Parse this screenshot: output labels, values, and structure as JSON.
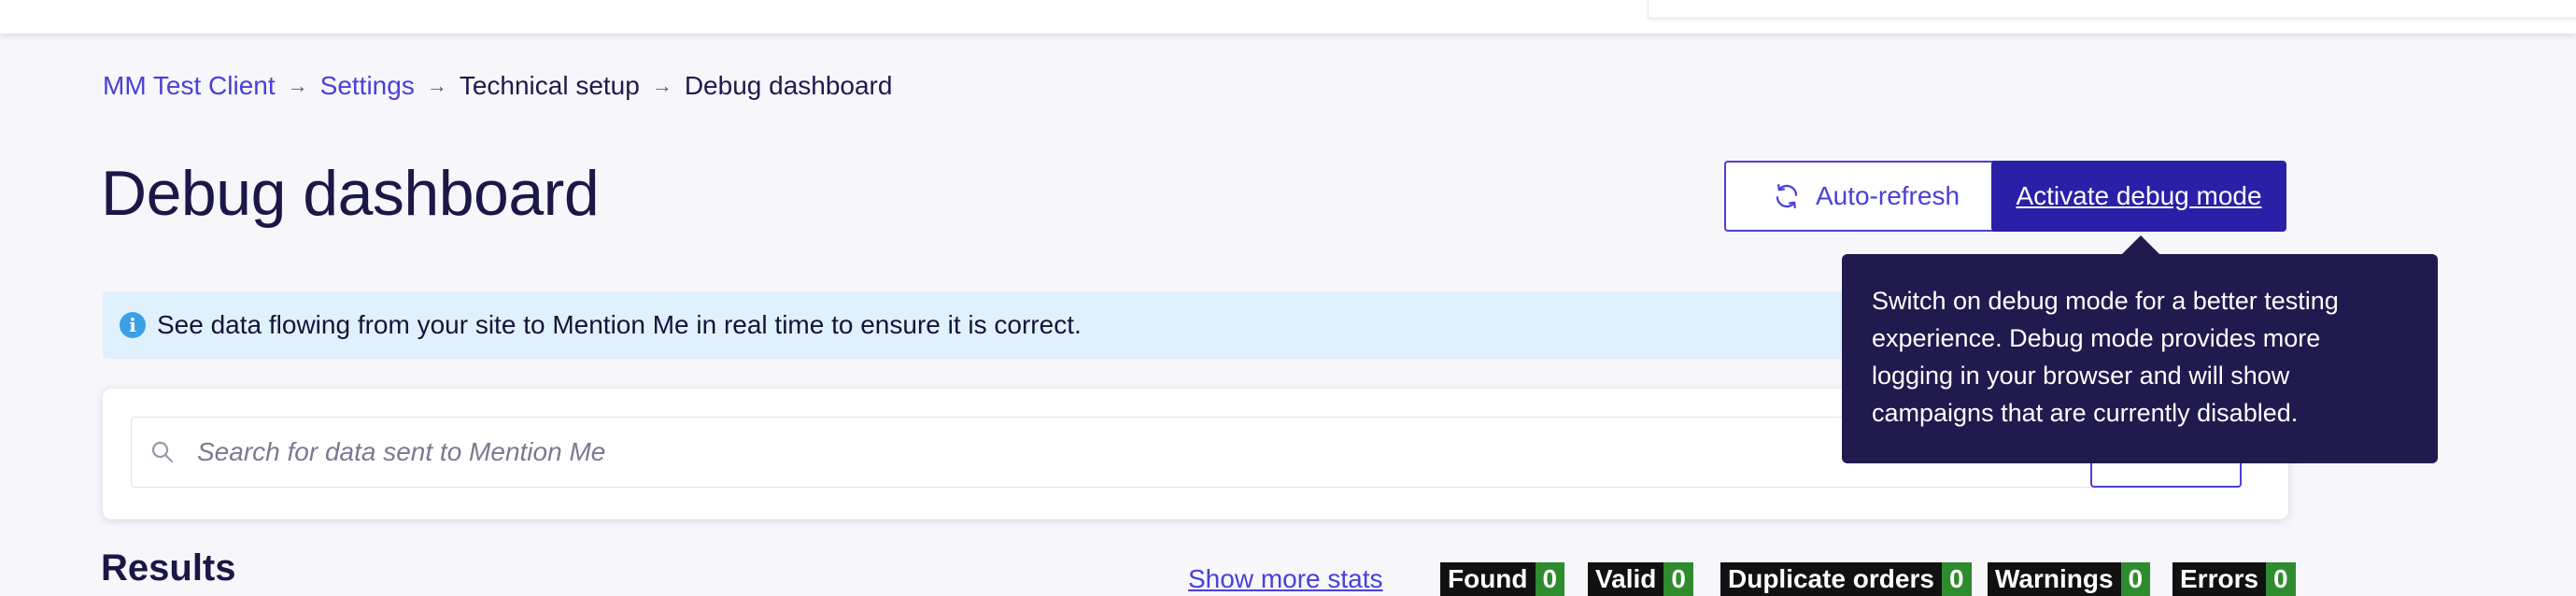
{
  "breadcrumb": {
    "items": [
      {
        "label": "MM Test Client",
        "link": true
      },
      {
        "label": "Settings",
        "link": true
      },
      {
        "label": "Technical setup",
        "link": false
      },
      {
        "label": "Debug dashboard",
        "link": false
      }
    ],
    "separator": "→"
  },
  "page": {
    "title": "Debug dashboard"
  },
  "actions": {
    "auto_refresh_label": "Auto-refresh",
    "activate_debug_label": "Activate debug mode"
  },
  "info_banner": {
    "icon": "i",
    "text": "See data flowing from your site to Mention Me in real time to ensure it is correct."
  },
  "search": {
    "placeholder": "Search for data sent to Mention Me"
  },
  "tooltip": {
    "text": "Switch on debug mode for a better testing experience. Debug mode provides more logging in your browser and will show campaigns that are currently disabled."
  },
  "results": {
    "title": "Results",
    "show_more_label": "Show more stats",
    "stats": [
      {
        "label": "Found",
        "count": "0"
      },
      {
        "label": "Valid",
        "count": "0"
      },
      {
        "label": "Duplicate orders",
        "count": "0"
      },
      {
        "label": "Warnings",
        "count": "0"
      },
      {
        "label": "Errors",
        "count": "0"
      }
    ]
  },
  "colors": {
    "primary": "#2a20a8",
    "link": "#4a3fd8",
    "tooltip_bg": "#201a4e",
    "banner_bg": "#dff1fc",
    "stat_count_bg": "#2e8b2e"
  }
}
